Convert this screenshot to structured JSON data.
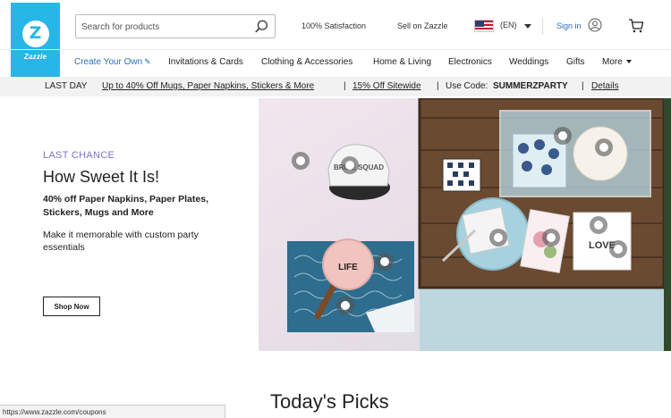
{
  "brand": {
    "logo_text": "Zazzle",
    "logo_letter": "Z"
  },
  "header": {
    "search_placeholder": "Search for products",
    "satisfaction": "100% Satisfaction",
    "sell": "Sell on Zazzle",
    "language": "(EN)",
    "sign_in": "Sign in"
  },
  "nav": {
    "items": [
      "Create Your Own",
      "Invitations & Cards",
      "Clothing & Accessories",
      "Home & Living",
      "Electronics",
      "Weddings",
      "Gifts",
      "More"
    ]
  },
  "promo": {
    "last_day": "LAST DAY",
    "offer1": "Up to 40% Off Mugs, Paper Napkins, Stickers & More",
    "sep1": "|",
    "offer2": "15% Off Sitewide",
    "sep2": "|",
    "use_code_label": "Use Code:",
    "code": "SUMMERZPARTY",
    "sep3": "|",
    "details": "Details"
  },
  "hero": {
    "eyebrow": "LAST CHANCE",
    "title": "How Sweet It Is!",
    "subtitle": "40% off Paper Napkins, Paper Plates, Stickers, Mugs and More",
    "body": "Make it memorable with custom party essentials",
    "cta": "Shop Now",
    "image_labels": {
      "hat": "BRIDE SQUAD",
      "paddle": "LIFE",
      "napkin": "LOVE"
    }
  },
  "section_title": "Today's Picks",
  "status_url": "https://www.zazzle.com/coupons",
  "colors": {
    "brand_blue": "#26b7e6",
    "link_blue": "#2a6ebb",
    "eyebrow_purple": "#7b74c7"
  }
}
